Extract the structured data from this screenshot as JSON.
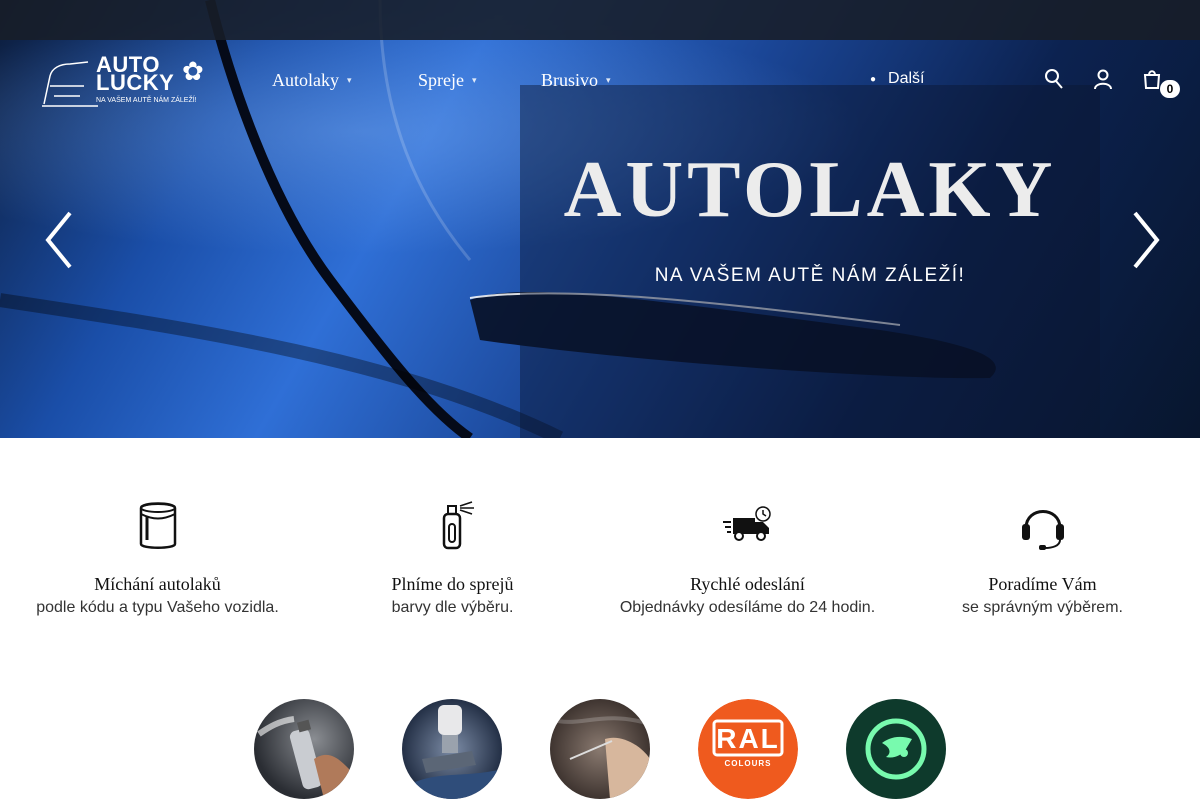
{
  "header": {
    "logo": {
      "line1": "AUTO",
      "line2": "LUCKY",
      "tagline": "NA VAŠEM AUTĚ NÁM ZÁLEŽÍ!"
    },
    "nav": [
      {
        "label": "Autolaky"
      },
      {
        "label": "Spreje"
      },
      {
        "label": "Brusivo"
      }
    ],
    "more_label": "Další",
    "cart_count": "0",
    "icons": [
      "search-icon",
      "user-icon",
      "cart-icon"
    ]
  },
  "hero": {
    "title": "AUTOLAKY",
    "subtitle": "NA VAŠEM AUTĚ NÁM ZÁLEŽÍ!"
  },
  "features": [
    {
      "icon": "paint-bucket-icon",
      "title": "Míchání autolaků",
      "desc": "podle kódu a typu Vašeho vozidla."
    },
    {
      "icon": "spray-can-icon",
      "title": "Plníme do sprejů",
      "desc": "barvy dle výběru."
    },
    {
      "icon": "delivery-truck-icon",
      "title": "Rychlé odeslání",
      "desc": "Objednávky odesíláme do 24 hodin."
    },
    {
      "icon": "headset-icon",
      "title": "Poradíme Vám",
      "desc": "se správným výběrem."
    }
  ],
  "categories": [
    {
      "name": "spray-category"
    },
    {
      "name": "spray-gun-category"
    },
    {
      "name": "touch-up-category"
    },
    {
      "name": "ral-category",
      "label": "RAL",
      "sublabel": "COLOURS"
    },
    {
      "name": "skoda-category"
    }
  ],
  "colors": {
    "ral": "#ef5a1e",
    "skoda": "#0e3a2c",
    "skoda_mark": "#78faae"
  }
}
